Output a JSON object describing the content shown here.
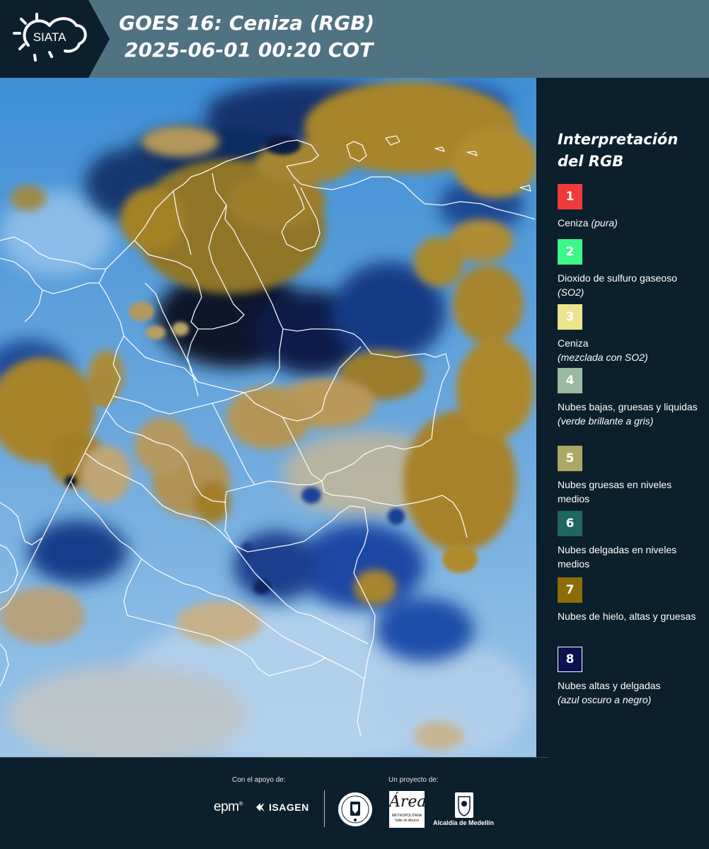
{
  "header": {
    "logo_text": "SIATA",
    "title_line1": "GOES 16: Ceniza (RGB)",
    "title_line2": "2025-06-01 00:20 COT"
  },
  "legend": {
    "title_line1": "Interpretación",
    "title_line2": "del RGB",
    "items": [
      {
        "number": "1",
        "color": "#f13b3b",
        "label": "Ceniza",
        "note": "(pura)"
      },
      {
        "number": "2",
        "color": "#3ef78a",
        "label": "Dioxido de sulfuro gaseoso",
        "note": "(SO2)"
      },
      {
        "number": "3",
        "color": "#ebe48c",
        "label": "Ceniza",
        "note": "(mezclada con SO2)"
      },
      {
        "number": "4",
        "color": "#9ab9a1",
        "label": "Nubes bajas, gruesas y liquidas",
        "note": "(verde brillante a gris)"
      },
      {
        "number": "5",
        "color": "#aaa863",
        "label": "Nubes gruesas en niveles medios",
        "note": ""
      },
      {
        "number": "6",
        "color": "#1f6660",
        "label": "Nubes delgadas en niveles medios",
        "note": ""
      },
      {
        "number": "7",
        "color": "#8c6c06",
        "label": "Nubes de hielo, altas y gruesas",
        "note": ""
      },
      {
        "number": "8",
        "color": "#0a1250",
        "label": "Nubes altas y delgadas",
        "note": "(azul oscuro a negro)"
      }
    ]
  },
  "footer": {
    "support_label": "Con el apoyo de:",
    "project_label": "Un proyecto de:",
    "sponsors": [
      "epm",
      "ISAGEN"
    ],
    "area_logo_text": "Área",
    "area_logo_subtitle": "METROPOLITANA Valle de Aburrá",
    "alcaldia_label": "Alcaldía de Medellín"
  },
  "colors": {
    "header_bg": "#4f7382",
    "panel_bg": "#0c1f2c",
    "ocean_blue": "#6fb2e8",
    "cloud_ochre": "#a5832a",
    "cloud_dark": "#0a1630"
  }
}
